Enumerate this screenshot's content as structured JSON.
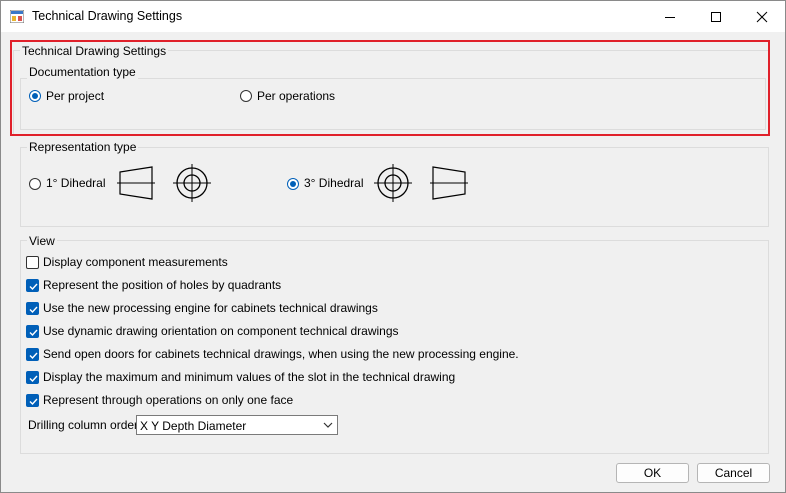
{
  "window": {
    "title": "Technical Drawing Settings",
    "icon": "app-settings-icon"
  },
  "group_main": {
    "legend": "Technical Drawing Settings"
  },
  "documentation": {
    "legend": "Documentation type",
    "options": [
      {
        "label": "Per project",
        "checked": true
      },
      {
        "label": "Per operations",
        "checked": false
      }
    ]
  },
  "representation": {
    "legend": "Representation type",
    "options": [
      {
        "label": "1° Dihedral",
        "checked": false
      },
      {
        "label": "3° Dihedral",
        "checked": true
      }
    ]
  },
  "view": {
    "legend": "View",
    "items": [
      {
        "label": "Display component measurements",
        "checked": false
      },
      {
        "label": "Represent the position of holes by quadrants",
        "checked": true
      },
      {
        "label": "Use the new processing engine for cabinets technical drawings",
        "checked": true
      },
      {
        "label": "Use dynamic drawing orientation on component technical drawings",
        "checked": true
      },
      {
        "label": "Send open doors for cabinets technical drawings, when using the new processing engine.",
        "checked": true
      },
      {
        "label": "Display the maximum and minimum values of the slot in the technical drawing",
        "checked": true
      },
      {
        "label": "Represent through operations on only one face",
        "checked": true
      }
    ],
    "drilling_label": "Drilling column order",
    "drilling_value": "X Y Depth Diameter"
  },
  "buttons": {
    "ok": "OK",
    "cancel": "Cancel"
  },
  "colors": {
    "accent": "#005fb8",
    "highlight": "#e0202a"
  }
}
